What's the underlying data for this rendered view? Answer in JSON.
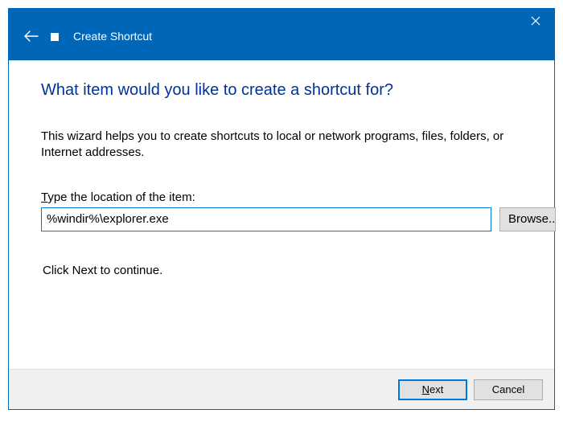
{
  "titlebar": {
    "title": "Create Shortcut"
  },
  "content": {
    "heading": "What item would you like to create a shortcut for?",
    "description": "This wizard helps you to create shortcuts to local or network programs, files, folders, or Internet addresses.",
    "location_label_prefix": "T",
    "location_label_rest": "ype the location of the item:",
    "location_value": "%windir%\\explorer.exe",
    "browse_label": "Browse...",
    "continue_text": "Click Next to continue."
  },
  "footer": {
    "next_u": "N",
    "next_rest": "ext",
    "cancel": "Cancel"
  }
}
